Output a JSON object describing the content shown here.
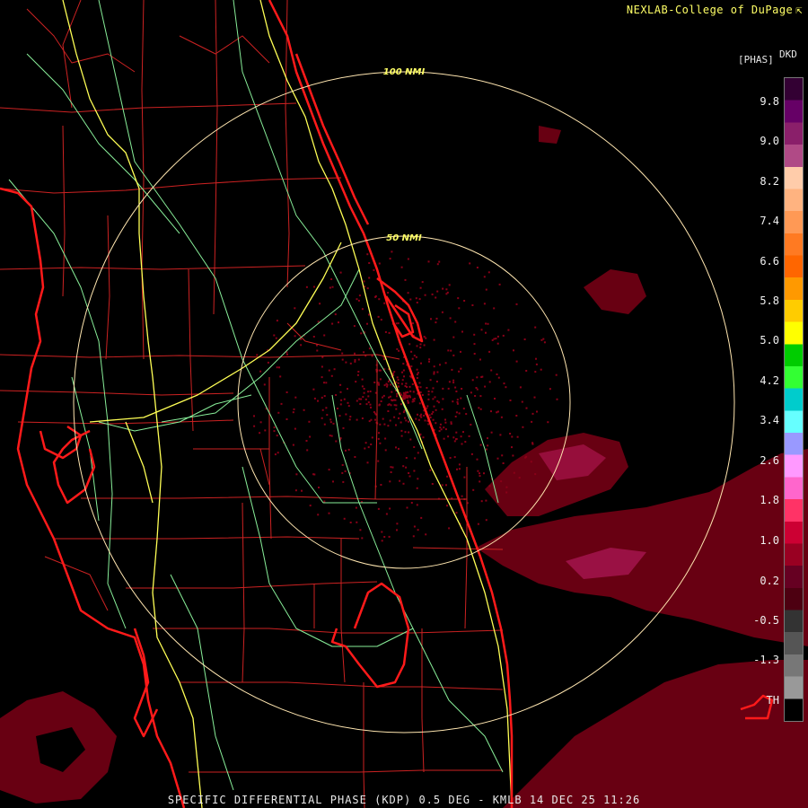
{
  "header": {
    "credit": "NEXLAB-College of DuPage",
    "corner_icon": "corner-arrow-icon"
  },
  "footer": {
    "caption": "SPECIFIC DIFFERENTIAL PHASE (KDP) 0.5 DEG - KMLB 14 DEC 25 11:26"
  },
  "range_rings": [
    {
      "label": "50 NMI"
    },
    {
      "label": "100 NMI"
    }
  ],
  "legend": {
    "product": "DKD",
    "units": "[PHAS]",
    "labels": [
      "9.8",
      "9.0",
      "8.2",
      "7.4",
      "6.6",
      "5.8",
      "5.0",
      "4.2",
      "3.4",
      "2.6",
      "1.8",
      "1.0",
      "0.2",
      "-0.5",
      "-1.3",
      "TH"
    ],
    "colors": [
      "#330033",
      "#660066",
      "#8a1f6a",
      "#b04a86",
      "#ffccaa",
      "#ffb380",
      "#ff9955",
      "#ff7a22",
      "#ff6600",
      "#ff9900",
      "#ffcc00",
      "#ffff00",
      "#00cc00",
      "#33ff33",
      "#00cccc",
      "#66ffff",
      "#9999ff",
      "#ff99ff",
      "#ff66cc",
      "#ff3366",
      "#cc0033",
      "#990022",
      "#660022",
      "#4d0011",
      "#333333",
      "#555555",
      "#777777",
      "#999999",
      "#000000"
    ]
  },
  "map_colors": {
    "coast": "#ff1a1a",
    "county": "#cc2222",
    "interstate": "#ffff55",
    "highway": "#88ee99",
    "ring": "#ffe6b0",
    "echo": "#7a0015"
  }
}
